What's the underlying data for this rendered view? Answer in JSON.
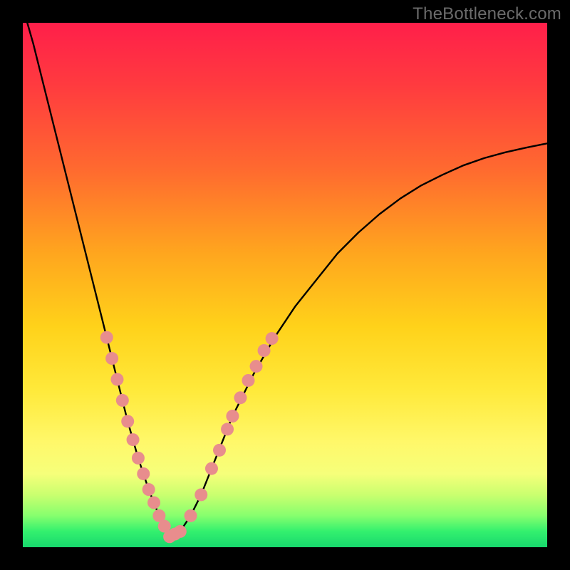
{
  "watermark": "TheBottleneck.com",
  "chart_data": {
    "type": "line",
    "title": "",
    "xlabel": "",
    "ylabel": "",
    "x_range": [
      0,
      1
    ],
    "y_range": [
      0,
      1
    ],
    "note": "Axes have no visible tick labels; x and y are normalized 0..1 fractions of the plotting box. y=0 is the bottom green edge; y=1 is the top red edge.",
    "series": [
      {
        "name": "bottleneck-curve",
        "description": "V-shaped curve; left descending branch is steeper than right ascending branch; minimum near x≈0.28, y≈0.02.",
        "x": [
          0.0,
          0.02,
          0.04,
          0.06,
          0.08,
          0.1,
          0.12,
          0.14,
          0.16,
          0.18,
          0.2,
          0.22,
          0.24,
          0.26,
          0.28,
          0.3,
          0.32,
          0.34,
          0.36,
          0.38,
          0.4,
          0.44,
          0.48,
          0.52,
          0.56,
          0.6,
          0.64,
          0.68,
          0.72,
          0.76,
          0.8,
          0.84,
          0.88,
          0.92,
          0.96,
          1.0
        ],
        "y": [
          1.03,
          0.96,
          0.88,
          0.8,
          0.72,
          0.64,
          0.56,
          0.48,
          0.4,
          0.32,
          0.24,
          0.17,
          0.11,
          0.06,
          0.02,
          0.03,
          0.06,
          0.1,
          0.15,
          0.2,
          0.25,
          0.33,
          0.4,
          0.46,
          0.51,
          0.56,
          0.6,
          0.635,
          0.665,
          0.69,
          0.71,
          0.728,
          0.742,
          0.753,
          0.762,
          0.77
        ]
      }
    ],
    "dots": {
      "name": "near-minimum-markers",
      "description": "Clustered pink circular markers along the curve flanks near the minimum.",
      "points": [
        {
          "x": 0.16,
          "y": 0.4
        },
        {
          "x": 0.17,
          "y": 0.36
        },
        {
          "x": 0.18,
          "y": 0.32
        },
        {
          "x": 0.19,
          "y": 0.28
        },
        {
          "x": 0.2,
          "y": 0.24
        },
        {
          "x": 0.21,
          "y": 0.205
        },
        {
          "x": 0.22,
          "y": 0.17
        },
        {
          "x": 0.23,
          "y": 0.14
        },
        {
          "x": 0.24,
          "y": 0.11
        },
        {
          "x": 0.25,
          "y": 0.085
        },
        {
          "x": 0.26,
          "y": 0.06
        },
        {
          "x": 0.27,
          "y": 0.04
        },
        {
          "x": 0.28,
          "y": 0.02
        },
        {
          "x": 0.29,
          "y": 0.025
        },
        {
          "x": 0.3,
          "y": 0.03
        },
        {
          "x": 0.32,
          "y": 0.06
        },
        {
          "x": 0.34,
          "y": 0.1
        },
        {
          "x": 0.36,
          "y": 0.15
        },
        {
          "x": 0.375,
          "y": 0.185
        },
        {
          "x": 0.39,
          "y": 0.225
        },
        {
          "x": 0.4,
          "y": 0.25
        },
        {
          "x": 0.415,
          "y": 0.285
        },
        {
          "x": 0.43,
          "y": 0.318
        },
        {
          "x": 0.445,
          "y": 0.345
        },
        {
          "x": 0.46,
          "y": 0.375
        },
        {
          "x": 0.475,
          "y": 0.398
        }
      ]
    },
    "gradient_stops": [
      {
        "pos": 0.0,
        "color": "#ff1f4a"
      },
      {
        "pos": 0.12,
        "color": "#ff3b3f"
      },
      {
        "pos": 0.28,
        "color": "#ff6a2f"
      },
      {
        "pos": 0.44,
        "color": "#ffa61e"
      },
      {
        "pos": 0.58,
        "color": "#ffd21a"
      },
      {
        "pos": 0.7,
        "color": "#ffe93a"
      },
      {
        "pos": 0.8,
        "color": "#fff86a"
      },
      {
        "pos": 0.86,
        "color": "#f6ff7a"
      },
      {
        "pos": 0.9,
        "color": "#caff6f"
      },
      {
        "pos": 0.94,
        "color": "#86ff6e"
      },
      {
        "pos": 0.97,
        "color": "#33f06e"
      },
      {
        "pos": 1.0,
        "color": "#18d86d"
      }
    ]
  }
}
